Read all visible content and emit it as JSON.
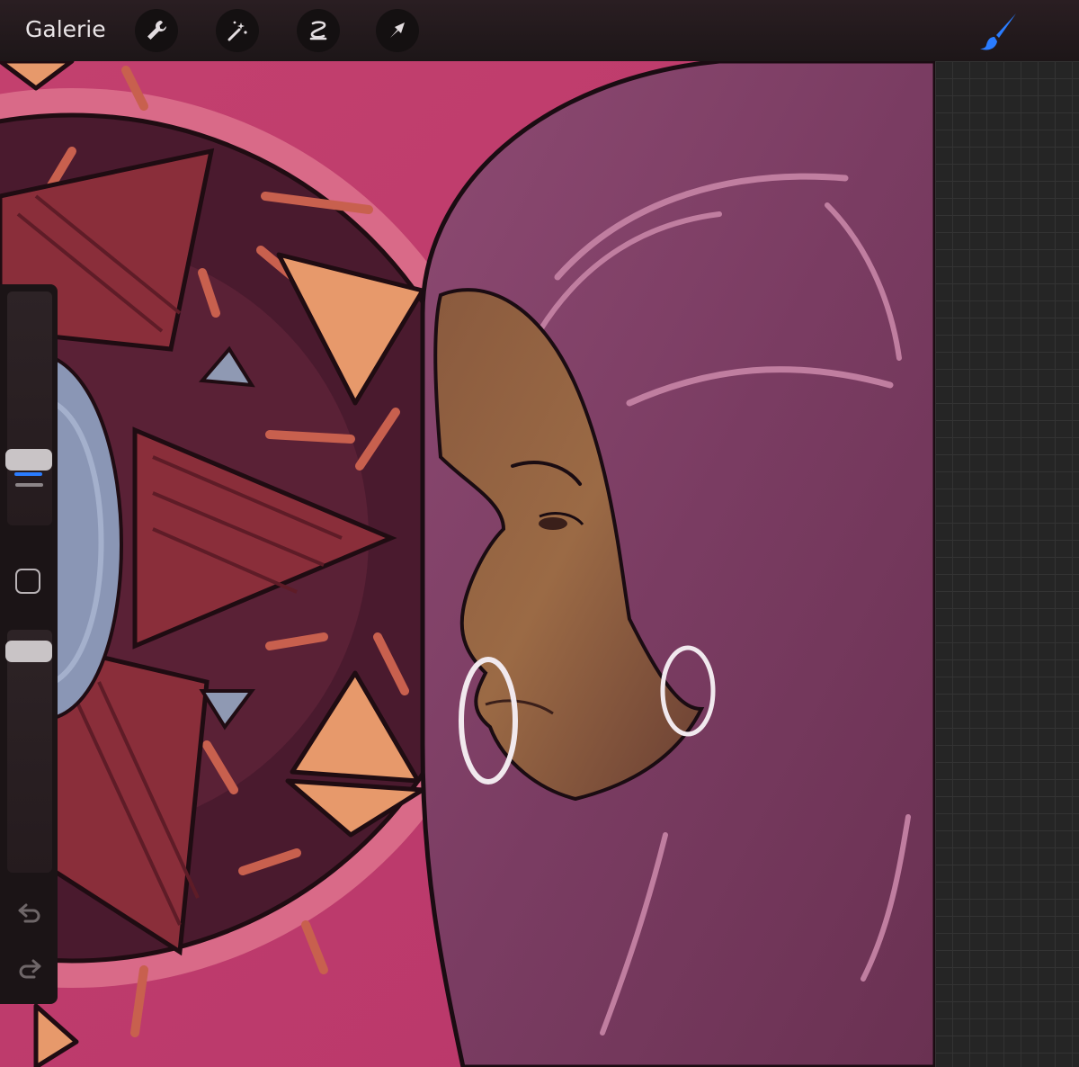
{
  "toolbar": {
    "gallery_label": "Galerie",
    "tools": [
      "wrench-icon",
      "magic-wand-icon",
      "selection-icon",
      "transform-arrow-icon"
    ],
    "active_tool": "brush-icon",
    "accent_color": "#2a7cff"
  },
  "sidebar": {
    "brush_size_control": "slider",
    "modify_button": "square-icon",
    "opacity_control": "slider",
    "undo": "undo-icon",
    "redo": "redo-icon"
  },
  "canvas": {
    "artwork": "painting"
  }
}
